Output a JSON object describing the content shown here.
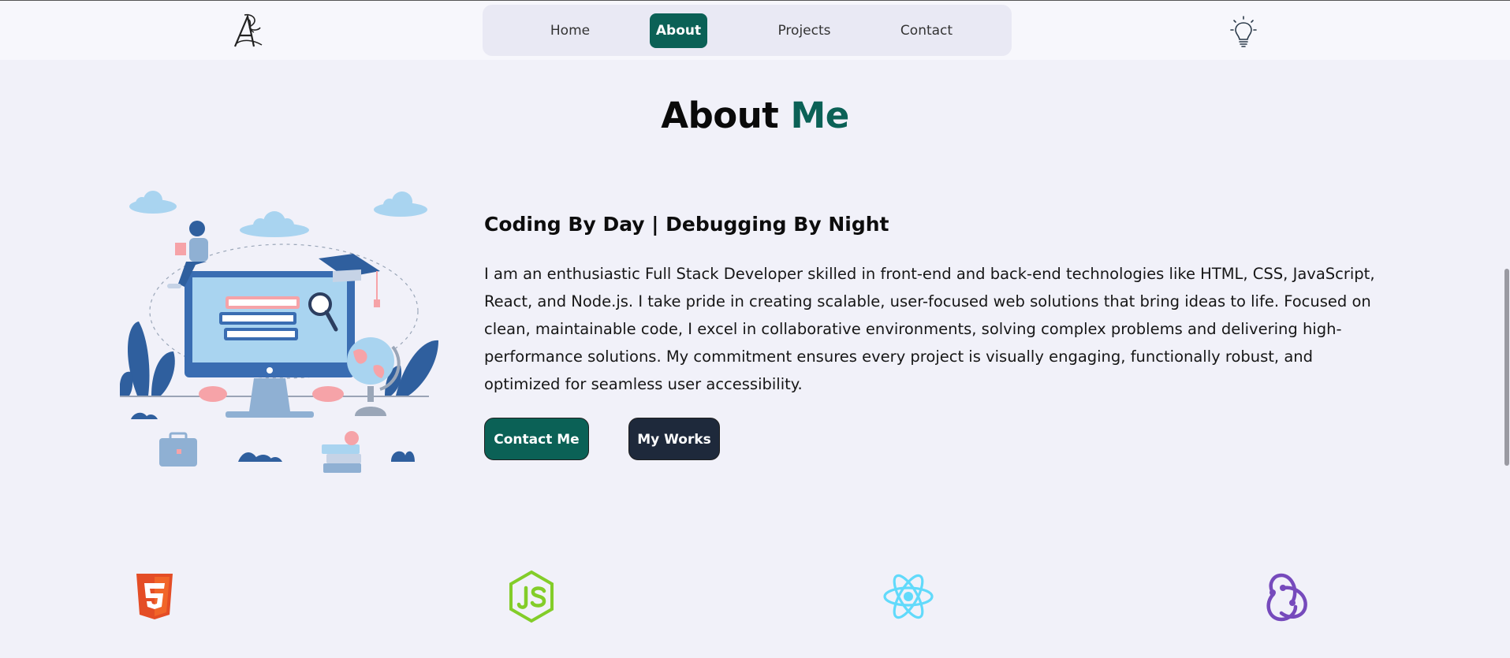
{
  "nav": {
    "items": [
      {
        "label": "Home",
        "active": false
      },
      {
        "label": "About",
        "active": true
      },
      {
        "label": "Projects",
        "active": false
      },
      {
        "label": "Contact",
        "active": false
      }
    ]
  },
  "icons": {
    "logo": "signature-logo-icon",
    "theme_toggle": "lightbulb-icon",
    "tech": [
      "html5-icon",
      "nodejs-icon",
      "react-icon",
      "redux-icon"
    ]
  },
  "about": {
    "title_main": "About",
    "title_accent": "Me",
    "tagline": "Coding By Day | Debugging By Night",
    "bio": "I am an enthusiastic Full Stack Developer skilled in front-end and back-end technologies like HTML, CSS, JavaScript, React, and Node.js. I take pride in creating scalable, user-focused web solutions that bring ideas to life. Focused on clean, maintainable code, I excel in collaborative environments, solving complex problems and delivering high-performance solutions. My commitment ensures every project is visually engaging, functionally robust, and optimized for seamless user accessibility.",
    "contact_button": "Contact Me",
    "works_button": "My Works"
  },
  "colors": {
    "accent": "#0b6156",
    "dark_button": "#1e293b",
    "background": "#f1f1f9"
  }
}
